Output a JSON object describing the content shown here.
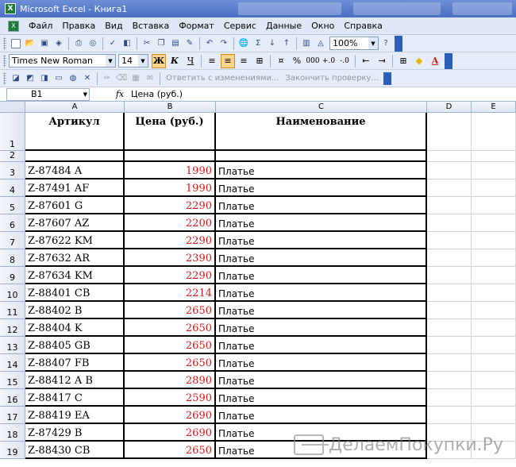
{
  "window": {
    "title": "Microsoft Excel - Книга1",
    "app_icon": "excel-icon"
  },
  "menu": [
    "Файл",
    "Правка",
    "Вид",
    "Вставка",
    "Формат",
    "Сервис",
    "Данные",
    "Окно",
    "Справка"
  ],
  "toolbar_standard": {
    "zoom": "100%"
  },
  "toolbar_format": {
    "font": "Times New Roman",
    "size": "14",
    "bold": "Ж",
    "italic": "К",
    "underline": "Ч",
    "percent": "%",
    "thousands": "000"
  },
  "toolbar_review": {
    "reply": "Ответить с изменениями...",
    "end_review": "Закончить проверку..."
  },
  "formula_bar": {
    "name_box": "B1",
    "fx": "fx",
    "content": "Цена (руб.)"
  },
  "columns": [
    "A",
    "B",
    "C",
    "D",
    "E"
  ],
  "header_row": {
    "row": "1",
    "a": "Артикул",
    "b": "Цена (руб.)",
    "c": "Наименование"
  },
  "empty_row": "2",
  "rows": [
    {
      "row": "3",
      "sku": "Z-87484 A",
      "price": "1990",
      "name": "Платье"
    },
    {
      "row": "4",
      "sku": "Z-87491 AF",
      "price": "1990",
      "name": "Платье"
    },
    {
      "row": "5",
      "sku": "Z-87601 G",
      "price": "2290",
      "name": "Платье"
    },
    {
      "row": "6",
      "sku": "Z-87607 AZ",
      "price": "2200",
      "name": "Платье"
    },
    {
      "row": "7",
      "sku": "Z-87622 KM",
      "price": "2290",
      "name": "Платье"
    },
    {
      "row": "8",
      "sku": "Z-87632 AR",
      "price": "2390",
      "name": "Платье"
    },
    {
      "row": "9",
      "sku": "Z-87634 KM",
      "price": "2290",
      "name": "Платье"
    },
    {
      "row": "10",
      "sku": "Z-88401 CB",
      "price": "2214",
      "name": "Платье"
    },
    {
      "row": "11",
      "sku": "Z-88402 B",
      "price": "2650",
      "name": "Платье"
    },
    {
      "row": "12",
      "sku": "Z-88404 K",
      "price": "2650",
      "name": "Платье"
    },
    {
      "row": "13",
      "sku": "Z-88405 GB",
      "price": "2650",
      "name": "Платье"
    },
    {
      "row": "14",
      "sku": "Z-88407 FB",
      "price": "2650",
      "name": "Платье"
    },
    {
      "row": "15",
      "sku": "Z-88412 A  B",
      "price": "2890",
      "name": "Платье"
    },
    {
      "row": "16",
      "sku": "Z-88417 C",
      "price": "2590",
      "name": "Платье"
    },
    {
      "row": "17",
      "sku": "Z-88419 EA",
      "price": "2690",
      "name": "Платье"
    },
    {
      "row": "18",
      "sku": "Z-87429 B",
      "price": "2690",
      "name": "Платье"
    },
    {
      "row": "19",
      "sku": "Z-88430 CB",
      "price": "2650",
      "name": "Платье"
    }
  ],
  "watermark": "ДелаемПокупки.Ру",
  "colors": {
    "price": "#d11a1a",
    "title_bar": "#4a6fc4",
    "toolbar": "#e6edf8"
  }
}
